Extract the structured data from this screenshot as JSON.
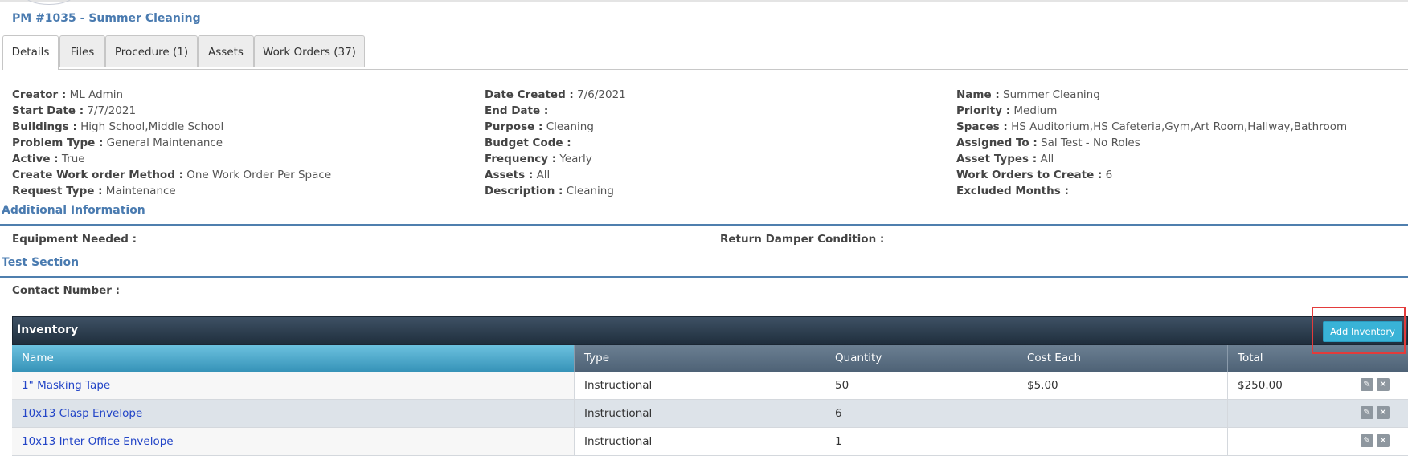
{
  "page": {
    "title": "PM #1035 - Summer Cleaning"
  },
  "tabs": [
    {
      "label": "Details",
      "active": true
    },
    {
      "label": "Files"
    },
    {
      "label": "Procedure (1)"
    },
    {
      "label": "Assets"
    },
    {
      "label": "Work Orders (37)"
    }
  ],
  "details": {
    "col1": [
      {
        "label": "Creator :",
        "value": "ML Admin"
      },
      {
        "label": "Start Date :",
        "value": "7/7/2021"
      },
      {
        "label": "Buildings :",
        "value": "High School,Middle School"
      },
      {
        "label": "Problem Type :",
        "value": "General Maintenance"
      },
      {
        "label": "Active :",
        "value": "True"
      },
      {
        "label": "Create Work order Method :",
        "value": "One Work Order Per Space"
      },
      {
        "label": "Request Type :",
        "value": "Maintenance"
      }
    ],
    "col2": [
      {
        "label": "Date Created :",
        "value": "7/6/2021"
      },
      {
        "label": "End Date :",
        "value": ""
      },
      {
        "label": "Purpose :",
        "value": "Cleaning"
      },
      {
        "label": "Budget Code :",
        "value": ""
      },
      {
        "label": "Frequency :",
        "value": "Yearly"
      },
      {
        "label": "Assets :",
        "value": "All"
      },
      {
        "label": "Description :",
        "value": "Cleaning"
      }
    ],
    "col3": [
      {
        "label": "Name :",
        "value": "Summer Cleaning"
      },
      {
        "label": "Priority :",
        "value": "Medium"
      },
      {
        "label": "Spaces :",
        "value": "HS Auditorium,HS Cafeteria,Gym,Art Room,Hallway,Bathroom"
      },
      {
        "label": "Assigned To :",
        "value": "Sal Test - No Roles"
      },
      {
        "label": "Asset Types :",
        "value": "All"
      },
      {
        "label": "Work Orders to Create :",
        "value": "6"
      },
      {
        "label": "Excluded Months :",
        "value": ""
      }
    ]
  },
  "additional_info": {
    "title": "Additional Information",
    "fields": [
      {
        "label": "Equipment Needed :",
        "value": ""
      },
      {
        "label": "Return Damper Condition :",
        "value": ""
      }
    ]
  },
  "test_section": {
    "title": "Test Section",
    "fields": [
      {
        "label": "Contact Number :",
        "value": ""
      }
    ]
  },
  "inventory": {
    "title": "Inventory",
    "add_button": "Add Inventory",
    "columns": [
      "Name",
      "Type",
      "Quantity",
      "Cost Each",
      "Total"
    ],
    "rows": [
      {
        "name": "1\" Masking Tape",
        "type": "Instructional",
        "quantity": "50",
        "cost_each": "$5.00",
        "total": "$250.00"
      },
      {
        "name": "10x13 Clasp Envelope",
        "type": "Instructional",
        "quantity": "6",
        "cost_each": "",
        "total": ""
      },
      {
        "name": "10x13 Inter Office Envelope",
        "type": "Instructional",
        "quantity": "1",
        "cost_each": "",
        "total": ""
      }
    ],
    "edit_icon": "pencil-icon",
    "delete_icon": "close-icon"
  }
}
